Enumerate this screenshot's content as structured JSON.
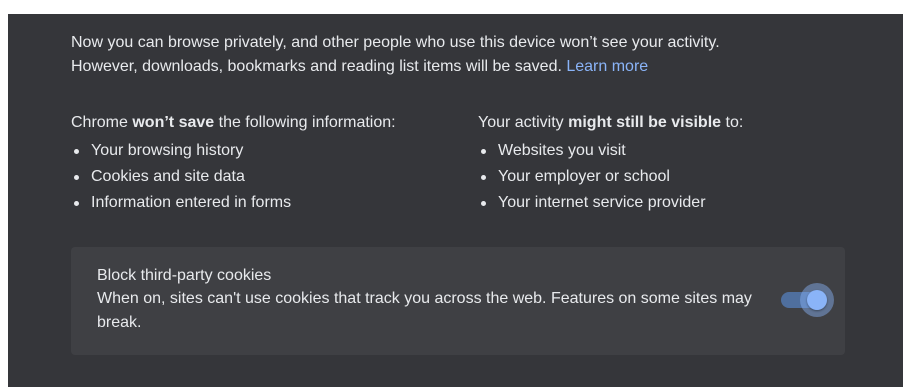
{
  "intro": {
    "line1": "Now you can browse privately, and other people who use this device won’t see your activity.",
    "line2": "However, downloads, bookmarks and reading list items will be saved.",
    "learn_more": "Learn more"
  },
  "not_saved": {
    "heading_prefix": "Chrome ",
    "heading_bold": "won’t save",
    "heading_suffix": " the following information:",
    "items": [
      "Your browsing history",
      "Cookies and site data",
      "Information entered in forms"
    ]
  },
  "still_visible": {
    "heading_prefix": "Your activity ",
    "heading_bold": "might still be visible",
    "heading_suffix": " to:",
    "items": [
      "Websites you visit",
      "Your employer or school",
      "Your internet service provider"
    ]
  },
  "cookie_card": {
    "title": "Block third-party cookies",
    "description": "When on, sites can't use cookies that track you across the web. Features on some sites may break.",
    "toggle_on": true
  },
  "colors": {
    "background": "#35363a",
    "card": "#3f4044",
    "text": "#e8eaed",
    "link": "#8ab4f8",
    "toggle_accent": "#8ab4f8"
  }
}
